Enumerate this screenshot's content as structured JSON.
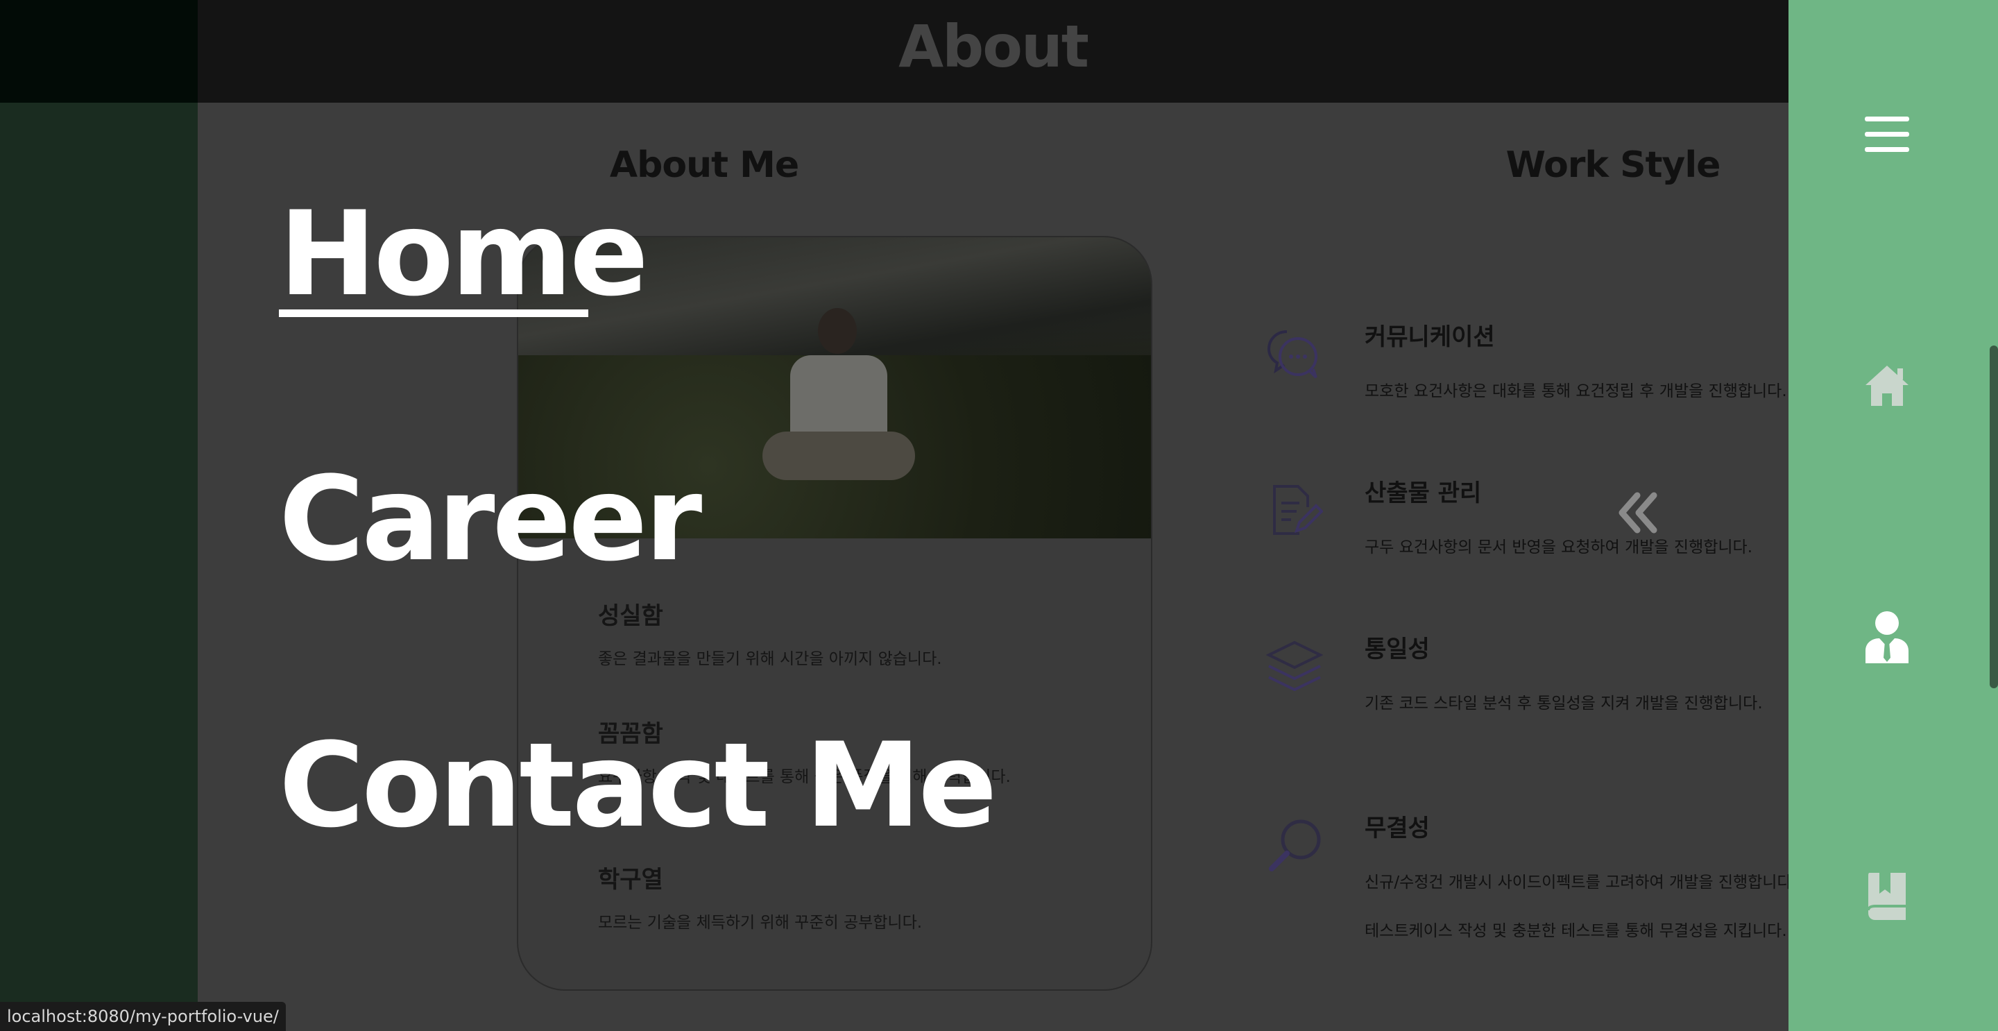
{
  "header": {
    "title": "About"
  },
  "about_me": {
    "heading": "About Me",
    "traits": [
      {
        "title": "성실함",
        "desc": "좋은 결과물을 만들기 위해 시간을 아끼지 않습니다."
      },
      {
        "title": "꼼꼼함",
        "desc": "요구사항 분석 및 테스트를 통해 높은 품질을 위해 노력합니다."
      },
      {
        "title": "학구열",
        "desc": "모르는 기술을 체득하기 위해 꾸준히 공부합니다."
      }
    ]
  },
  "work_style": {
    "heading": "Work Style",
    "items": [
      {
        "title": "커뮤니케이션",
        "desc": [
          "모호한 요건사항은 대화를 통해 요건정립 후 개발을 진행합니다."
        ]
      },
      {
        "title": "산출물 관리",
        "desc": [
          "구두 요건사항의 문서 반영을 요청하여 개발을 진행합니다."
        ]
      },
      {
        "title": "통일성",
        "desc": [
          "기존 코드 스타일 분석 후 통일성을 지켜 개발을 진행합니다."
        ]
      },
      {
        "title": "무결성",
        "desc": [
          "신규/수정건 개발시 사이드이펙트를 고려하여 개발을 진행합니다.",
          "테스트케이스 작성 및 충분한 테스트를 통해 무결성을 지킵니다."
        ]
      }
    ]
  },
  "nav_menu": {
    "home": "Home",
    "career": "Career",
    "contact": "Contact Me"
  },
  "sidebar": {
    "icons": [
      "menu-icon",
      "home-icon",
      "person-icon",
      "bookmark-book-icon"
    ]
  },
  "status_bar": {
    "url": "localhost:8080/my-portfolio-vue/"
  },
  "colors": {
    "sidebar": "#6fb685",
    "overlay_text": "#ffffff",
    "page_bg": "#3d3d3d"
  }
}
